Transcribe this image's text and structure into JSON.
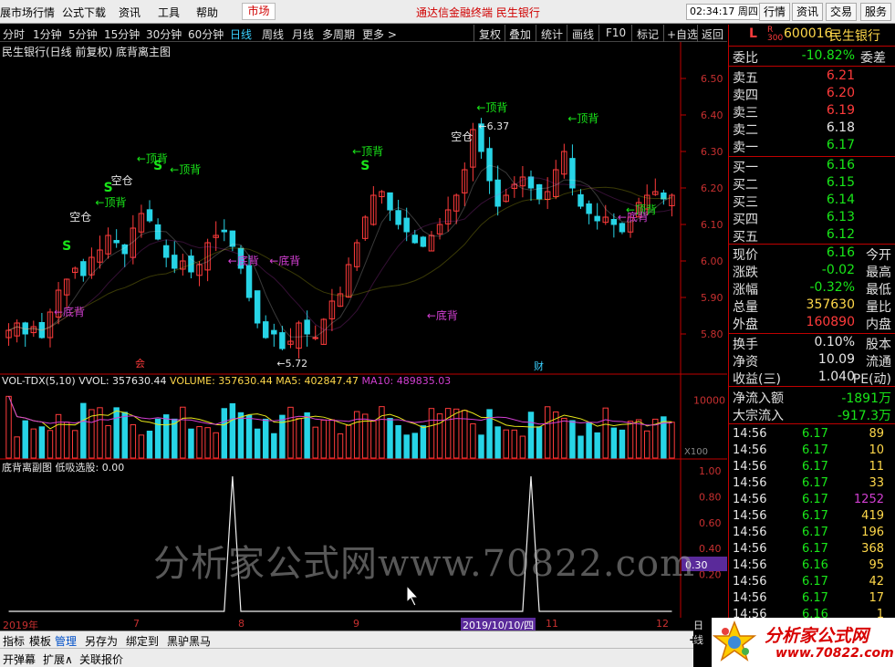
{
  "menubar": {
    "items": [
      "展市场行情",
      "公式下载",
      "资讯",
      "工具",
      "帮助"
    ],
    "market_tab": "市场",
    "center_title": "通达信金融终端  民生银行",
    "time": "02:34:17 周四",
    "buttons": [
      "行情",
      "资讯",
      "交易",
      "服务"
    ]
  },
  "periodbar": {
    "periods": [
      "分时",
      "1分钟",
      "5分钟",
      "15分钟",
      "30分钟",
      "60分钟",
      "日线",
      "周线",
      "月线",
      "多周期",
      "更多 >"
    ],
    "active": "日线",
    "tools": [
      "复权",
      "叠加",
      "统计",
      "画线",
      "F10",
      "标记",
      "+自选",
      "返回"
    ]
  },
  "chart": {
    "title": "民生银行(日线 前复权)  底背离主图",
    "price_ticks": [
      "6.50",
      "6.40",
      "6.30",
      "6.20",
      "6.10",
      "6.00",
      "5.90",
      "5.80"
    ],
    "annotations": {
      "high_label": "6.37",
      "low_label": "5.72",
      "kongcang": "空仓",
      "dingbei": "←顶背",
      "dibei": "←底背",
      "s": "S",
      "cai": "财"
    }
  },
  "volpanel": {
    "name": "VOL-TDX(5,10)",
    "vvol": "VVOL: 357630.44",
    "volume": "VOLUME: 357630.44",
    "ma5": "MA5: 402847.47",
    "ma10": "MA10: 489835.03",
    "tick": "10000",
    "multiplier": "X100"
  },
  "indpanel": {
    "title": "底背离副图  低吸选股: 0.00",
    "ticks": [
      "1.00",
      "0.80",
      "0.60",
      "0.40",
      "0.20"
    ],
    "cursor_value": "0.30"
  },
  "datebar": {
    "labels": [
      "2019年",
      "7",
      "8",
      "9",
      "11",
      "12"
    ],
    "cursor_date": "2019/10/10/四",
    "right_label": "日线"
  },
  "tabs": [
    "指标",
    "模板",
    "管理",
    "另存为",
    "绑定到",
    "黑驴黑马"
  ],
  "statusbar": [
    "开弹幕",
    "扩展∧",
    "关联报价"
  ],
  "quote": {
    "code_prefix": "L",
    "code": "600016",
    "name": "民生银行",
    "weibi_label": "委比",
    "weibi_value": "-10.82%",
    "weicha_label": "委差",
    "asks": [
      {
        "label": "卖五",
        "price": "6.21"
      },
      {
        "label": "卖四",
        "price": "6.20"
      },
      {
        "label": "卖三",
        "price": "6.19"
      },
      {
        "label": "卖二",
        "price": "6.18"
      },
      {
        "label": "卖一",
        "price": "6.17"
      }
    ],
    "bids": [
      {
        "label": "买一",
        "price": "6.16"
      },
      {
        "label": "买二",
        "price": "6.15"
      },
      {
        "label": "买三",
        "price": "6.14"
      },
      {
        "label": "买四",
        "price": "6.13"
      },
      {
        "label": "买五",
        "price": "6.12"
      }
    ],
    "stats": [
      {
        "label": "现价",
        "value": "6.16",
        "label2": "今开"
      },
      {
        "label": "涨跌",
        "value": "-0.02",
        "label2": "最高"
      },
      {
        "label": "涨幅",
        "value": "-0.32%",
        "label2": "最低"
      },
      {
        "label": "总量",
        "value": "357630",
        "label2": "量比"
      },
      {
        "label": "外盘",
        "value": "160890",
        "label2": "内盘"
      }
    ],
    "stats2": [
      {
        "label": "换手",
        "value": "0.10%",
        "label2": "股本"
      },
      {
        "label": "净资",
        "value": "10.09",
        "label2": "流通"
      },
      {
        "label": "收益(三)",
        "value": "1.040",
        "label2": "PE(动)"
      }
    ],
    "flows": [
      {
        "label": "净流入额",
        "value": "-1891万"
      },
      {
        "label": "大宗流入",
        "value": "-917.3万"
      }
    ],
    "ticks": [
      {
        "time": "14:56",
        "price": "6.17",
        "vol": "89"
      },
      {
        "time": "14:56",
        "price": "6.17",
        "vol": "10"
      },
      {
        "time": "14:56",
        "price": "6.17",
        "vol": "11"
      },
      {
        "time": "14:56",
        "price": "6.17",
        "vol": "33"
      },
      {
        "time": "14:56",
        "price": "6.17",
        "vol": "1252"
      },
      {
        "time": "14:56",
        "price": "6.17",
        "vol": "419"
      },
      {
        "time": "14:56",
        "price": "6.17",
        "vol": "196"
      },
      {
        "time": "14:56",
        "price": "6.17",
        "vol": "368"
      },
      {
        "time": "14:56",
        "price": "6.16",
        "vol": "95"
      },
      {
        "time": "14:56",
        "price": "6.17",
        "vol": "42"
      },
      {
        "time": "14:56",
        "price": "6.17",
        "vol": "17"
      },
      {
        "time": "14:56",
        "price": "6.16",
        "vol": "1"
      }
    ]
  },
  "watermark": "分析家公式网www.70822.com",
  "logo": {
    "text": "分析家公式网",
    "url": "www.70822.com"
  },
  "colors": {
    "up": "#ff3b3b",
    "down": "#27d4e6",
    "price_green": "#19e619",
    "ma5": "#e6e6e6",
    "ma10": "#d23fd2",
    "ma20": "#e6e619",
    "frame": "#c00000"
  },
  "chart_data": {
    "type": "candlestick",
    "price_range": [
      5.7,
      6.55
    ],
    "note": "daily candles, 2019 Jun–Dec",
    "closes": [
      5.81,
      5.83,
      5.8,
      5.82,
      5.79,
      5.86,
      5.92,
      5.95,
      5.98,
      5.96,
      6.01,
      6.03,
      6.07,
      6.05,
      6.02,
      6.09,
      6.13,
      6.11,
      6.06,
      6.01,
      5.98,
      6.0,
      5.97,
      5.99,
      6.05,
      6.07,
      6.08,
      6.04,
      5.98,
      5.9,
      5.83,
      5.79,
      5.8,
      5.76,
      5.78,
      5.83,
      5.8,
      5.79,
      5.84,
      5.89,
      5.91,
      5.99,
      6.05,
      6.12,
      6.18,
      6.19,
      6.14,
      6.1,
      6.08,
      6.05,
      6.04,
      6.07,
      6.1,
      6.14,
      6.18,
      6.25,
      6.36,
      6.3,
      6.22,
      6.15,
      6.18,
      6.21,
      6.23,
      6.2,
      6.17,
      6.19,
      6.25,
      6.3,
      6.2,
      6.15,
      6.13,
      6.11,
      6.12,
      6.1,
      6.08,
      6.12,
      6.16,
      6.18,
      6.19,
      6.17,
      6.18
    ],
    "volume_range": [
      0,
      12000
    ],
    "indicator_spikes_index": [
      27,
      63
    ]
  }
}
